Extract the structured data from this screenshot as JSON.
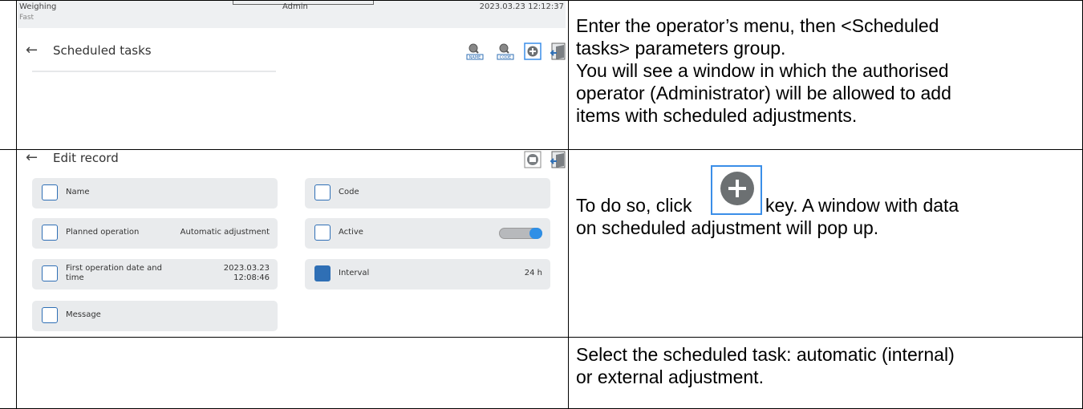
{
  "screen1": {
    "status_mode": "Weighing",
    "status_sub": "Fast",
    "status_user": "Admin",
    "status_datetime": "2023.03.23 12:12:37",
    "title": "Scheduled tasks",
    "icons": [
      "search-name-icon",
      "search-code-icon",
      "add-icon",
      "exit-icon"
    ],
    "icon_labels": {
      "name": "NAME",
      "code": "CODE"
    }
  },
  "desc1": {
    "lines": [
      "Enter the operator’s menu, then <Scheduled",
      "tasks> parameters group.",
      "You will see a window in which the authorised",
      "operator (Administrator) will be allowed to add",
      "items with scheduled adjustments."
    ]
  },
  "screen2": {
    "title": "Edit record",
    "fields": {
      "name": "Name",
      "code": "Code",
      "planned_operation": "Planned operation",
      "planned_operation_value": "Automatic adjustment",
      "active": "Active",
      "first_date_l1": "First operation date and",
      "first_date_l2": "time",
      "first_date_v1": "2023.03.23",
      "first_date_v2": "12:08:46",
      "interval": "Interval",
      "interval_value": "24 h",
      "message": "Message"
    },
    "active_on": true
  },
  "desc2": {
    "before": "To do so, click",
    "after": "key. A window with data",
    "line2": "on scheduled adjustment will pop up."
  },
  "desc3": {
    "lines": [
      "Select the scheduled task: automatic (internal)",
      "or external adjustment."
    ]
  }
}
